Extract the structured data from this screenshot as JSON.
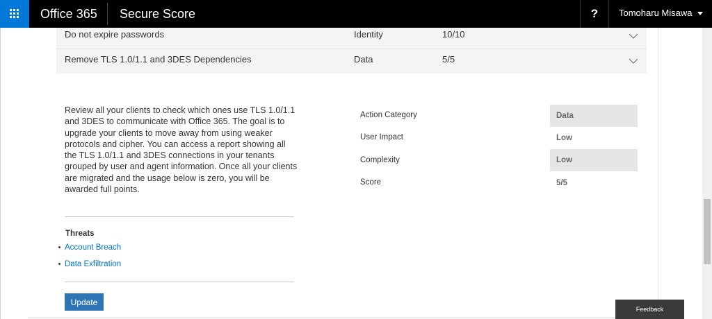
{
  "header": {
    "brand": "Office 365",
    "app_title": "Secure Score",
    "help_label": "?",
    "user_name": "Tomoharu Misawa"
  },
  "actions": [
    {
      "name": "Do not expire passwords",
      "category": "Identity",
      "score": "10/10"
    },
    {
      "name": "Remove TLS 1.0/1.1 and 3DES Dependencies",
      "category": "Data",
      "score": "5/5"
    }
  ],
  "detail": {
    "description": "Review all your clients to check which ones use TLS 1.0/1.1 and 3DES to communicate with Office 365. The goal is to upgrade your clients to move away from using weaker protocols and cipher. You can access a report showing all the TLS 1.0/1.1 and 3DES connections in your tenants grouped by user and agent information. Once all your clients are migrated and the usage below is zero, you will be awarded full points.",
    "threats_title": "Threats",
    "threats": [
      "Account Breach",
      "Data Exfiltration"
    ],
    "update_label": "Update",
    "properties": [
      {
        "label": "Action Category",
        "value": "Data"
      },
      {
        "label": "User Impact",
        "value": "Low"
      },
      {
        "label": "Complexity",
        "value": "Low"
      },
      {
        "label": "Score",
        "value": "5/5"
      }
    ]
  },
  "feedback_label": "Feedback",
  "icons": {
    "waffle": "app-launcher-icon",
    "chevron": "chevron-down-icon",
    "caret": "caret-down-icon"
  },
  "colors": {
    "waffle_bg": "#0078d7",
    "link": "#0072c6",
    "button": "#2e75b6"
  }
}
